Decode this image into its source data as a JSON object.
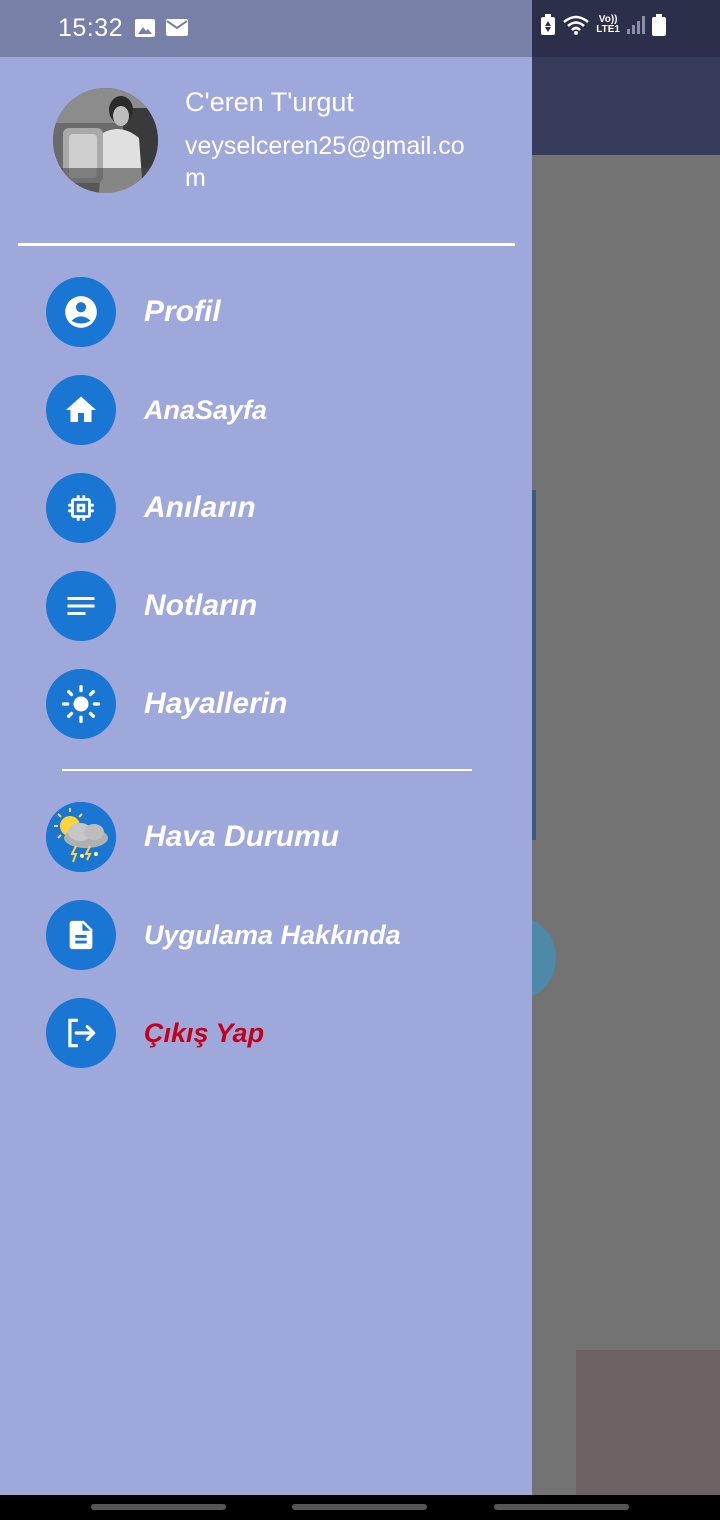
{
  "status_bar": {
    "time": "15:32",
    "icons": [
      "image-icon",
      "mail-icon",
      "battery-saver-icon",
      "wifi-icon",
      "lte-icon",
      "signal-icon",
      "battery-icon"
    ],
    "lte_top": "Vo))",
    "lte_bottom": "LTE1"
  },
  "drawer": {
    "background": "#9fa8da",
    "user": {
      "name": "C'eren T'urgut",
      "email": "veyselceren25@gmail.com"
    },
    "menu": [
      {
        "label": "Profil",
        "icon": "account-circle-icon"
      },
      {
        "label": "AnaSayfa",
        "icon": "home-icon"
      },
      {
        "label": "Anıların",
        "icon": "memory-chip-icon"
      },
      {
        "label": "Notların",
        "icon": "notes-icon"
      },
      {
        "label": "Hayallerin",
        "icon": "sun-icon"
      }
    ],
    "secondary_menu": [
      {
        "label": "Hava Durumu",
        "icon": "weather-icon"
      },
      {
        "label": "Uygulama Hakkında",
        "icon": "document-icon"
      },
      {
        "label": "Çıkış Yap",
        "icon": "logout-icon",
        "color": "#c4001a"
      }
    ],
    "icon_circle_color": "#1976d2"
  }
}
